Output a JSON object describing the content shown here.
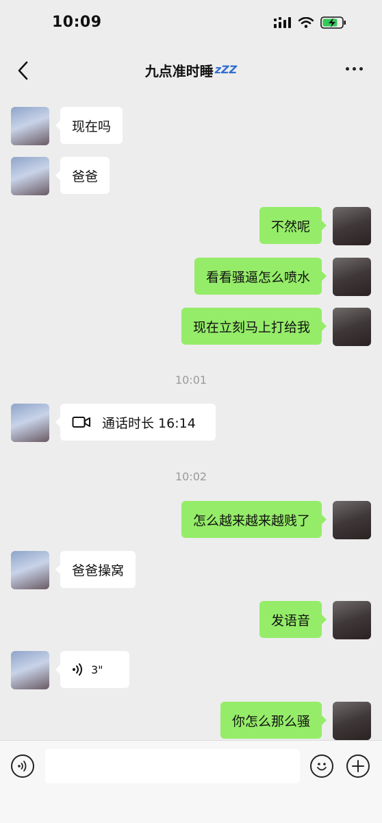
{
  "status_bar": {
    "time": "10:09"
  },
  "header": {
    "title": "九点准时睡",
    "title_emoji_text": "zZZ"
  },
  "messages": [
    {
      "side": "in",
      "text": "现在吗"
    },
    {
      "side": "in",
      "text": "爸爸"
    },
    {
      "side": "out",
      "text": "不然呢"
    },
    {
      "side": "out",
      "text": "看看骚逼怎么喷水"
    },
    {
      "side": "out",
      "text": "现在立刻马上打给我"
    },
    {
      "type": "timestamp",
      "text": "10:01"
    },
    {
      "side": "in",
      "type": "video_call",
      "text": "通话时长 16:14"
    },
    {
      "type": "timestamp",
      "text": "10:02"
    },
    {
      "side": "out",
      "text": "怎么越来越来越贱了"
    },
    {
      "side": "in",
      "text": "爸爸操窝"
    },
    {
      "side": "out",
      "text": "发语音"
    },
    {
      "side": "in",
      "type": "voice",
      "text": "3\""
    },
    {
      "side": "out",
      "text": "你怎么那么骚"
    }
  ],
  "input_bar": {
    "placeholder": ""
  },
  "icons": [
    "back-icon",
    "more-icon",
    "voice-toggle-icon",
    "emoji-icon",
    "plus-icon",
    "video-call-icon",
    "voice-wave-icon",
    "signal-icon",
    "wifi-icon",
    "battery-icon"
  ],
  "colors": {
    "background": "#ededed",
    "outgoing_bubble": "#95ec69",
    "incoming_bubble": "#ffffff"
  }
}
